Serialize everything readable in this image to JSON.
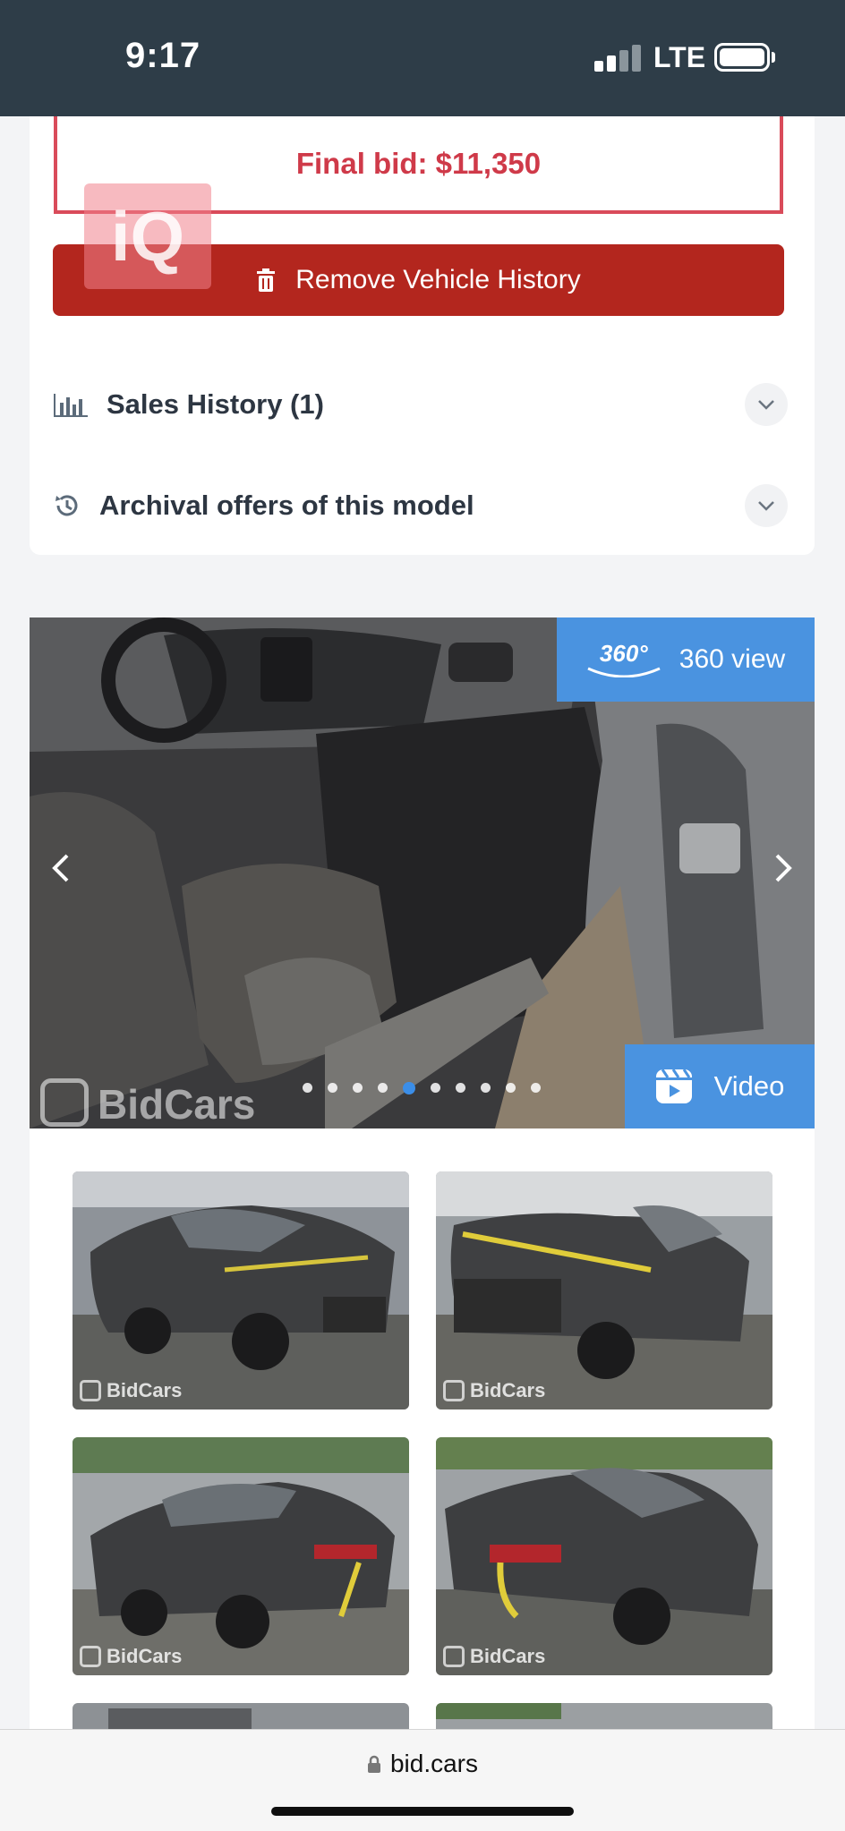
{
  "status_bar": {
    "time": "9:17",
    "network": "LTE"
  },
  "bid": {
    "final_bid": "Final bid: $11,350"
  },
  "watermark": {
    "text": "iQ"
  },
  "actions": {
    "remove_history": "Remove Vehicle History"
  },
  "accordion": [
    {
      "label": "Sales History (1)",
      "icon": "bar-chart-icon"
    },
    {
      "label": "Archival offers of this model",
      "icon": "history-icon"
    }
  ],
  "gallery": {
    "view_360_label": "360 view",
    "view_360_badge": "360°",
    "video_label": "Video",
    "brand_watermark": "BidCars",
    "dot_count": 10,
    "active_dot": 4,
    "thumb_tag": "BidCars"
  },
  "browser": {
    "url": "bid.cars"
  },
  "colors": {
    "status_bg": "#2e3d48",
    "danger": "#b3261e",
    "bid_red": "#cf3a49",
    "accent_blue": "#4a93e0"
  }
}
